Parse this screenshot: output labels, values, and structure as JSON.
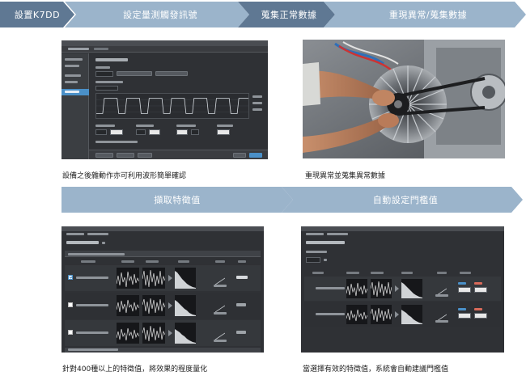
{
  "flow_top": {
    "step1": "設置K7DD",
    "step2": "設定量測觸發訊號",
    "step3": "蒐集正常數據",
    "step4": "重現異常/蒐集數據"
  },
  "flow_mid": {
    "step1": "擷取特徵值",
    "step2": "自動設定門檻值"
  },
  "captions": {
    "top_left": "設備之後雜動作亦可利用波形簡單確認",
    "top_right": "重現異常並蒐集異常數據",
    "bottom_left": "針對400種以上的特徵值，將效果的程度量化",
    "bottom_right": "當選擇有效的特徵值，系統會自動建議門檻值"
  },
  "colors": {
    "chevron_dark": "#5f7893",
    "chevron_light": "#9bb4cb",
    "screen_bg": "#2f3135",
    "accent_blue": "#4a90c8"
  }
}
